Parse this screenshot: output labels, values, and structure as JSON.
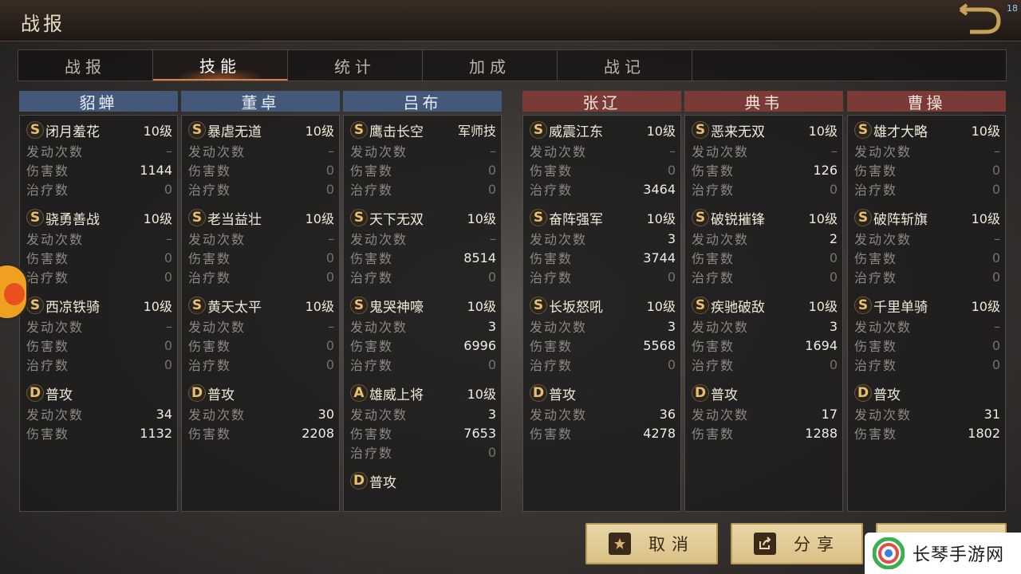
{
  "header": {
    "title": "战报",
    "corner_number": "18"
  },
  "tabs": [
    "战报",
    "技能",
    "统计",
    "加成",
    "战记"
  ],
  "active_tab": 1,
  "columns": [
    {
      "name": "貂蝉",
      "side": "blue",
      "skills": [
        {
          "grade": "S",
          "name": "闭月羞花",
          "level": "10级",
          "stats": [
            [
              "发动次数",
              "–"
            ],
            [
              "伤害数",
              "1144"
            ],
            [
              "治疗数",
              "0"
            ]
          ]
        },
        {
          "grade": "S",
          "name": "骁勇善战",
          "level": "10级",
          "stats": [
            [
              "发动次数",
              "–"
            ],
            [
              "伤害数",
              "0"
            ],
            [
              "治疗数",
              "0"
            ]
          ]
        },
        {
          "grade": "S",
          "name": "西凉铁骑",
          "level": "10级",
          "stats": [
            [
              "发动次数",
              "–"
            ],
            [
              "伤害数",
              "0"
            ],
            [
              "治疗数",
              "0"
            ]
          ]
        },
        {
          "grade": "D",
          "name": "普攻",
          "level": "",
          "stats": [
            [
              "发动次数",
              "34"
            ],
            [
              "伤害数",
              "1132"
            ]
          ]
        }
      ]
    },
    {
      "name": "董卓",
      "side": "blue",
      "skills": [
        {
          "grade": "S",
          "name": "暴虐无道",
          "level": "10级",
          "stats": [
            [
              "发动次数",
              "–"
            ],
            [
              "伤害数",
              "0"
            ],
            [
              "治疗数",
              "0"
            ]
          ]
        },
        {
          "grade": "S",
          "name": "老当益壮",
          "level": "10级",
          "stats": [
            [
              "发动次数",
              "–"
            ],
            [
              "伤害数",
              "0"
            ],
            [
              "治疗数",
              "0"
            ]
          ]
        },
        {
          "grade": "S",
          "name": "黄天太平",
          "level": "10级",
          "stats": [
            [
              "发动次数",
              "–"
            ],
            [
              "伤害数",
              "0"
            ],
            [
              "治疗数",
              "0"
            ]
          ]
        },
        {
          "grade": "D",
          "name": "普攻",
          "level": "",
          "stats": [
            [
              "发动次数",
              "30"
            ],
            [
              "伤害数",
              "2208"
            ]
          ]
        }
      ]
    },
    {
      "name": "吕布",
      "side": "blue",
      "skills": [
        {
          "grade": "S",
          "name": "鹰击长空",
          "level": "军师技",
          "stats": [
            [
              "发动次数",
              "–"
            ],
            [
              "伤害数",
              "0"
            ],
            [
              "治疗数",
              "0"
            ]
          ]
        },
        {
          "grade": "S",
          "name": "天下无双",
          "level": "10级",
          "stats": [
            [
              "发动次数",
              "–"
            ],
            [
              "伤害数",
              "8514"
            ],
            [
              "治疗数",
              "0"
            ]
          ]
        },
        {
          "grade": "S",
          "name": "鬼哭神嚎",
          "level": "10级",
          "stats": [
            [
              "发动次数",
              "3"
            ],
            [
              "伤害数",
              "6996"
            ],
            [
              "治疗数",
              "0"
            ]
          ]
        },
        {
          "grade": "A",
          "name": "雄威上将",
          "level": "10级",
          "stats": [
            [
              "发动次数",
              "3"
            ],
            [
              "伤害数",
              "7653"
            ],
            [
              "治疗数",
              "0"
            ]
          ]
        },
        {
          "grade": "D",
          "name": "普攻",
          "level": "",
          "stats": []
        }
      ]
    },
    {
      "name": "张辽",
      "side": "red",
      "skills": [
        {
          "grade": "S",
          "name": "威震江东",
          "level": "10级",
          "stats": [
            [
              "发动次数",
              "–"
            ],
            [
              "伤害数",
              "0"
            ],
            [
              "治疗数",
              "3464"
            ]
          ]
        },
        {
          "grade": "S",
          "name": "奋阵强军",
          "level": "10级",
          "stats": [
            [
              "发动次数",
              "3"
            ],
            [
              "伤害数",
              "3744"
            ],
            [
              "治疗数",
              "0"
            ]
          ]
        },
        {
          "grade": "S",
          "name": "长坂怒吼",
          "level": "10级",
          "stats": [
            [
              "发动次数",
              "3"
            ],
            [
              "伤害数",
              "5568"
            ],
            [
              "治疗数",
              "0"
            ]
          ]
        },
        {
          "grade": "D",
          "name": "普攻",
          "level": "",
          "stats": [
            [
              "发动次数",
              "36"
            ],
            [
              "伤害数",
              "4278"
            ]
          ]
        }
      ]
    },
    {
      "name": "典韦",
      "side": "red",
      "skills": [
        {
          "grade": "S",
          "name": "恶来无双",
          "level": "10级",
          "stats": [
            [
              "发动次数",
              "–"
            ],
            [
              "伤害数",
              "126"
            ],
            [
              "治疗数",
              "0"
            ]
          ]
        },
        {
          "grade": "S",
          "name": "破锐摧锋",
          "level": "10级",
          "stats": [
            [
              "发动次数",
              "2"
            ],
            [
              "伤害数",
              "0"
            ],
            [
              "治疗数",
              "0"
            ]
          ]
        },
        {
          "grade": "S",
          "name": "疾驰破敌",
          "level": "10级",
          "stats": [
            [
              "发动次数",
              "3"
            ],
            [
              "伤害数",
              "1694"
            ],
            [
              "治疗数",
              "0"
            ]
          ]
        },
        {
          "grade": "D",
          "name": "普攻",
          "level": "",
          "stats": [
            [
              "发动次数",
              "17"
            ],
            [
              "伤害数",
              "1288"
            ]
          ]
        }
      ]
    },
    {
      "name": "曹操",
      "side": "red",
      "skills": [
        {
          "grade": "S",
          "name": "雄才大略",
          "level": "10级",
          "stats": [
            [
              "发动次数",
              "–"
            ],
            [
              "伤害数",
              "0"
            ],
            [
              "治疗数",
              "0"
            ]
          ]
        },
        {
          "grade": "S",
          "name": "破阵斩旗",
          "level": "10级",
          "stats": [
            [
              "发动次数",
              "–"
            ],
            [
              "伤害数",
              "0"
            ],
            [
              "治疗数",
              "0"
            ]
          ]
        },
        {
          "grade": "S",
          "name": "千里单骑",
          "level": "10级",
          "stats": [
            [
              "发动次数",
              "–"
            ],
            [
              "伤害数",
              "0"
            ],
            [
              "治疗数",
              "0"
            ]
          ]
        },
        {
          "grade": "D",
          "name": "普攻",
          "level": "",
          "stats": [
            [
              "发动次数",
              "31"
            ],
            [
              "伤害数",
              "1802"
            ]
          ]
        }
      ]
    }
  ],
  "buttons": {
    "cancel": "取消",
    "share": "分享"
  },
  "watermark": {
    "text": "长琴手游网"
  },
  "colors": {
    "blue_header": "#44587a",
    "red_header": "#7a3a36",
    "accent_gold": "#e6c070",
    "tab_active": "#d8804a"
  }
}
